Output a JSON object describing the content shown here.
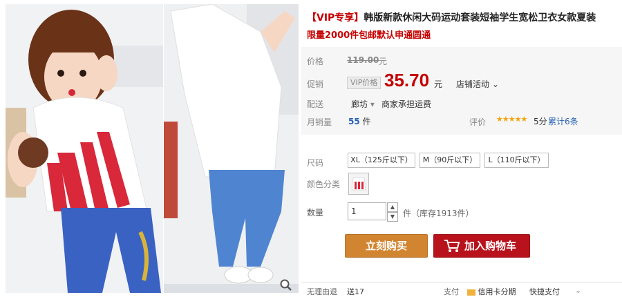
{
  "product": {
    "title_prefix": "【VIP专享】",
    "title": "韩版新款休闲大码运动套装短袖学生宽松卫衣女款夏装",
    "subtitle": "限量2000件包邮默认申通圆通"
  },
  "price": {
    "label": "价格",
    "original": "119.00",
    "currency": "元"
  },
  "promo": {
    "label": "促销",
    "tag": "VIP价格",
    "price": "35.70",
    "currency": "元",
    "activity": "店铺活动"
  },
  "shipping": {
    "label": "配送",
    "location": "廊坊",
    "note": "商家承担运费"
  },
  "sales": {
    "label": "月销量",
    "count": "55",
    "unit": "件"
  },
  "rating": {
    "label": "评价",
    "stars": "★★★★★",
    "score": "5分",
    "total": "累计6条"
  },
  "sizes": {
    "label": "尺码",
    "options": [
      "XL（125斤以下）",
      "M（90斤以下）",
      "L（110斤以下）"
    ]
  },
  "color": {
    "label": "颜色分类"
  },
  "quantity": {
    "label": "数量",
    "value": "1",
    "stock": "件（库存1913件）"
  },
  "actions": {
    "buy": "立刻购买",
    "cart": "加入购物车"
  },
  "footer": {
    "item1": "无理由退",
    "item2": "送17",
    "item3": "支付",
    "item4": "信用卡分期",
    "item5": "快捷支付"
  },
  "colors": {
    "accent_red": "#c40000",
    "buy_orange": "#d28530",
    "cart_red": "#b8131c",
    "link_blue": "#2862b4"
  }
}
